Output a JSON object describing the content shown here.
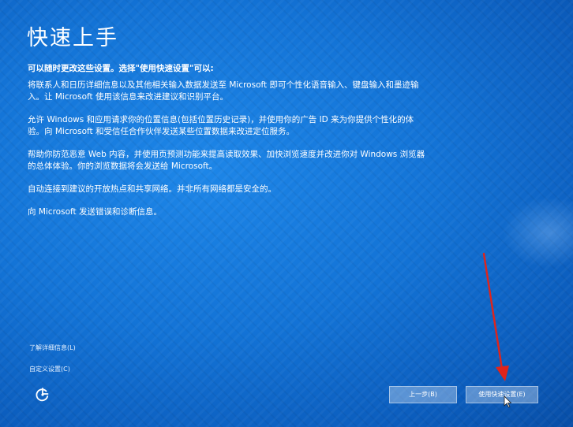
{
  "page": {
    "title": "快速上手",
    "intro": "可以随时更改这些设置。选择\"使用快速设置\"可以:",
    "paragraphs": [
      "将联系人和日历详细信息以及其他相关输入数据发送至 Microsoft 即可个性化语音输入、键盘输入和墨迹输入。让 Microsoft 使用该信息来改进建议和识别平台。",
      "允许 Windows 和应用请求你的位置信息(包括位置历史记录)，并使用你的广告 ID 来为你提供个性化的体验。向 Microsoft 和受信任合作伙伴发送某些位置数据来改进定位服务。",
      "帮助你防范恶意 Web 内容，并使用页预测功能来提高读取效果、加快浏览速度并改进你对 Windows 浏览器的总体体验。你的浏览数据将会发送给 Microsoft。",
      "自动连接到建议的开放热点和共享网络。并非所有网络都是安全的。",
      "向 Microsoft 发送错误和诊断信息。"
    ]
  },
  "links": {
    "learn_more": "了解详细信息(L)",
    "customize": "自定义设置(C)"
  },
  "buttons": {
    "back": "上一步(B)",
    "express": "使用快速设置(E)"
  },
  "icons": {
    "accessibility": "ease-of-access-icon",
    "annotation": "red-arrow-annotation",
    "cursor": "mouse-pointer-icon"
  },
  "colors": {
    "background": "#1373d6",
    "annotation_arrow": "#e0241b"
  }
}
